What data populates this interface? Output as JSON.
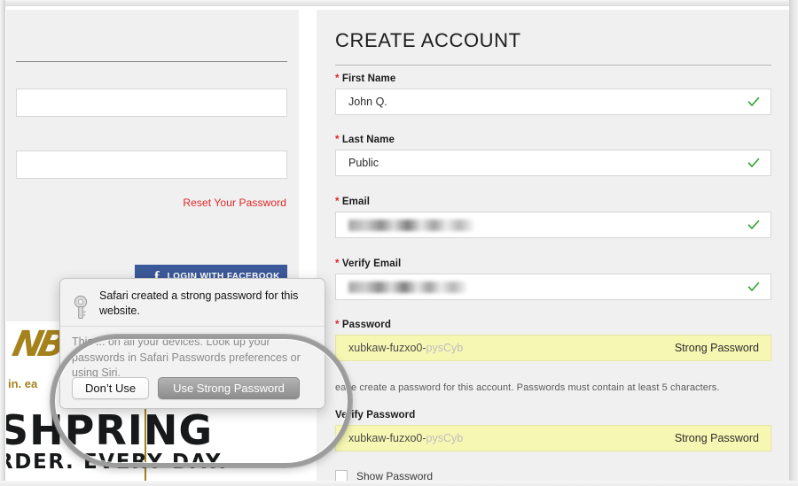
{
  "left_panel": {
    "reset_link": "Reset Your Password",
    "facebook_button": {
      "icon": "facebook-f-icon",
      "label": "LOGIN WITH FACEBOOK",
      "color": "#3b5998"
    },
    "email_input_value": "",
    "password_input_value": ""
  },
  "promo": {
    "logo_text": "NB",
    "subline": "in. ea",
    "headline": "SHPRING",
    "tagline": "RDER. EVERY DAY.",
    "brand_color": "#a5821b"
  },
  "right_panel": {
    "title": "CREATE ACCOUNT",
    "fields": [
      {
        "label": "First Name",
        "required": true,
        "value": "John Q.",
        "state": "valid",
        "style": "white"
      },
      {
        "label": "Last Name",
        "required": true,
        "value": "Public",
        "state": "valid",
        "style": "white"
      },
      {
        "label": "Email",
        "required": true,
        "value": "",
        "state": "valid",
        "style": "white",
        "redacted": true
      },
      {
        "label": "Verify Email",
        "required": true,
        "value": "",
        "state": "valid",
        "style": "white",
        "redacted": true
      },
      {
        "label": "Password",
        "required": true,
        "value": "xubkaw-fuzxo0-pysCyb",
        "state": "strong",
        "style": "yellow"
      },
      {
        "label": "Verify Password",
        "required": false,
        "value": "xubkaw-fuzxo0-pysCyb",
        "state": "strong",
        "style": "yellow"
      }
    ],
    "password_head": "xubkaw-fuzxo0-",
    "password_tail": "pysCyb",
    "strong_password_tag": "Strong Password",
    "password_help": "ease create a password for this account. Passwords must contain at least 5 characters.",
    "show_password_label": "Show Password",
    "check_color": "#2ba02b",
    "required_marker_color": "#e02727",
    "yellow_field_color": "#f7f7b4"
  },
  "safari_popover": {
    "icon": "key-icon",
    "headline": "Safari created a strong password for this website.",
    "body": "This ... on all your devices. Look up your passwords in Safari Passwords preferences or using Siri.",
    "dont_use_label": "Don’t Use",
    "use_strong_label": "Use Strong Password"
  }
}
